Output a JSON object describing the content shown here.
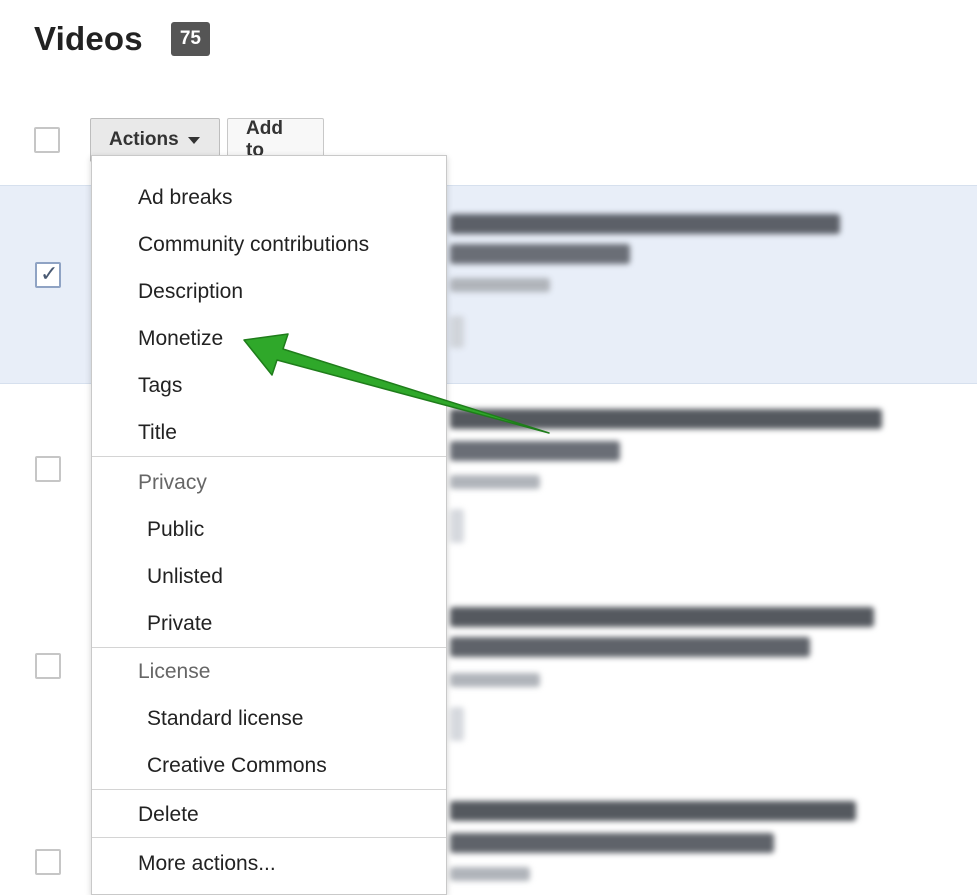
{
  "header": {
    "title": "Videos",
    "count": "75"
  },
  "toolbar": {
    "actions_label": "Actions",
    "add_to_label": "Add to"
  },
  "menu": {
    "items": [
      "Ad breaks",
      "Community contributions",
      "Description",
      "Monetize",
      "Tags",
      "Title"
    ],
    "privacy": {
      "header": "Privacy",
      "options": [
        "Public",
        "Unlisted",
        "Private"
      ]
    },
    "license": {
      "header": "License",
      "options": [
        "Standard license",
        "Creative Commons"
      ]
    },
    "delete_label": "Delete",
    "more_label": "More actions..."
  },
  "rows": [
    {
      "checked": true
    },
    {
      "checked": false
    },
    {
      "checked": false
    },
    {
      "checked": false
    }
  ],
  "colors": {
    "annotation_arrow": "#2fa82a",
    "selected_row": "#e8eef8",
    "badge": "#555555"
  }
}
